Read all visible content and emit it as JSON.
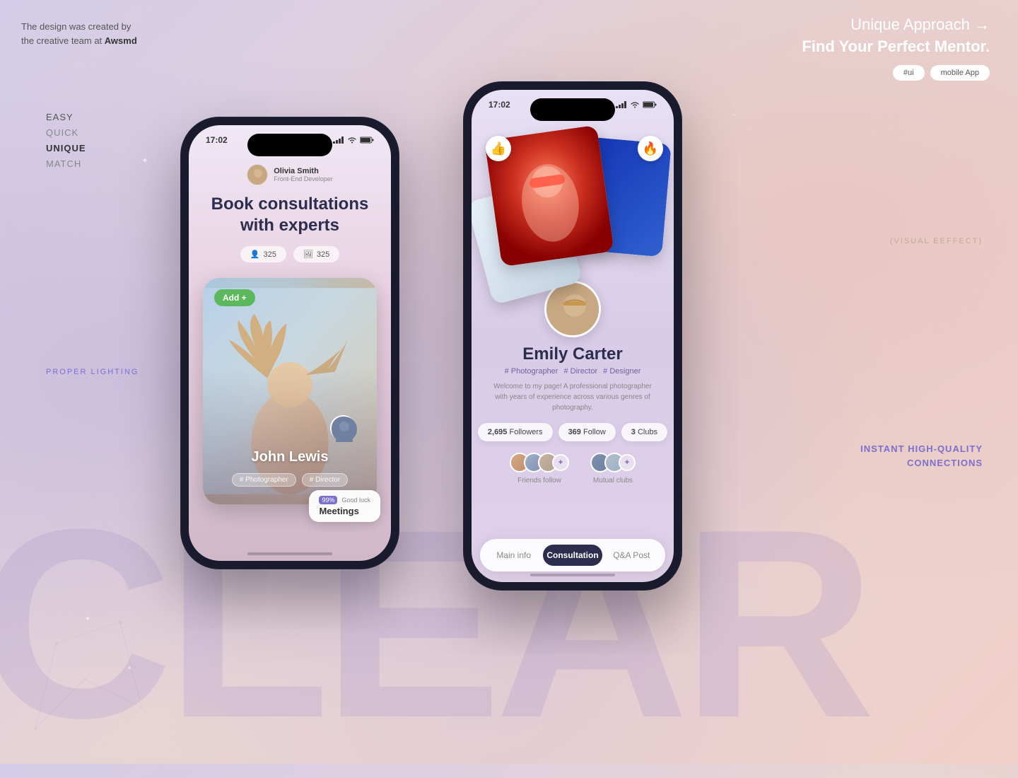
{
  "meta": {
    "credit_line1": "The design was created by",
    "credit_line2": "the creative team at ",
    "credit_brand": "Awsmd"
  },
  "headline": {
    "line1": "Unique Approach  →",
    "line2": "Find Your Perfect Mentor.",
    "tag1": "#ui",
    "tag2": "mobile App"
  },
  "left_labels": {
    "easy": "EASY",
    "quick": "QUICK",
    "unique": "UNIQUE",
    "match": "MATCH"
  },
  "proper_lighting": "PROPER LIGHTING",
  "visual_effect": "(VISUAL EEFFECT)",
  "instant_connections": "INSTANT HIGH-QUALITY\nCONNECTIONS",
  "phone1": {
    "time": "17:02",
    "user_name": "Olivia Smith",
    "user_role": "Front-End Developer",
    "title_line1": "Book consultations",
    "title_line2": "with experts",
    "stat1_icon": "👤",
    "stat1": "325",
    "stat2_icon": "🖼",
    "stat2": "325",
    "add_button": "Add +",
    "card_name": "John Lewis",
    "card_tag1": "# Photographer",
    "card_tag2": "# Director",
    "meeting_percent": "99%",
    "meeting_label": "Good luck",
    "meeting_text": "Meetings"
  },
  "phone2": {
    "time": "17:02",
    "name": "Emily Carter",
    "tag1": "# Photographer",
    "tag2": "# Director",
    "tag3": "# Designer",
    "bio": "Welcome to my page! A professional photographer with years of experience across various genres of photography.",
    "followers_count": "2,695",
    "followers_label": "Followers",
    "follow_count": "369",
    "follow_label": "Follow",
    "clubs_count": "3",
    "clubs_label": "Clubs",
    "friends_follow_label": "Friends follow",
    "mutual_clubs_label": "Mutual clubs",
    "tab1": "Main info",
    "tab2": "Consultation",
    "tab3": "Q&A Post"
  },
  "bg_text": "CLEAR"
}
